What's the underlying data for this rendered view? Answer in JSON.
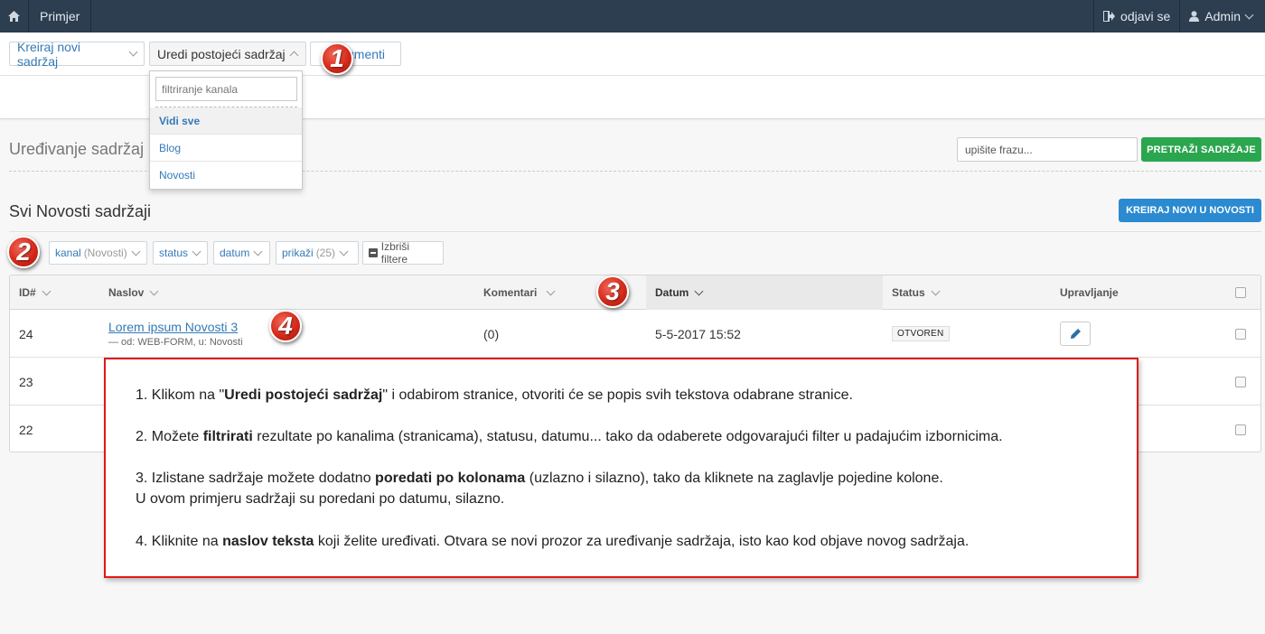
{
  "navbar": {
    "home_icon": "home-icon",
    "brand": "Primjer",
    "logout": "odjavi se",
    "user": "Admin"
  },
  "toolbar": {
    "create_new": "Kreiraj novi sadržaj",
    "edit_existing": "Uredi postojeći sadržaj",
    "documents": "Dokumenti",
    "documents_visible": "umenti"
  },
  "dropdown": {
    "filter_placeholder": "filtriranje kanala",
    "items": [
      "Vidi sve",
      "Blog",
      "Novosti"
    ]
  },
  "section": {
    "title": "Uređivanje sadržaja",
    "title_visible": "Uređivanje sadržaj",
    "search_placeholder": "upišite frazu...",
    "search_button": "PRETRAŽI SADRŽAJE"
  },
  "list": {
    "title": "Svi Novosti sadržaji",
    "create_button": "KREIRAJ NOVI U NOVOSTI"
  },
  "filters": {
    "channel": "kanal",
    "channel_value": "(Novosti)",
    "status": "status",
    "date": "datum",
    "show": "prikaži",
    "show_value": "(25)",
    "clear": "Izbriši filtere"
  },
  "table": {
    "headers": {
      "id": "ID#",
      "title": "Naslov",
      "comments": "Komentari",
      "date": "Datum",
      "status": "Status",
      "manage": "Upravljanje"
    },
    "rows": [
      {
        "id": "24",
        "title": "Lorem ipsum Novosti 3",
        "meta": "— od: WEB-FORM, u: Novosti",
        "comments": "(0)",
        "date": "5-5-2017 15:52",
        "status": "OTVOREN"
      },
      {
        "id": "23"
      },
      {
        "id": "22"
      }
    ]
  },
  "markers": [
    "1",
    "2",
    "3",
    "4"
  ],
  "instructions": {
    "l1_pre": "1. Klikom na \"",
    "l1_bold": "Uredi postojeći sadržaj",
    "l1_post": "\" i odabirom stranice, otvoriti će se popis svih tekstova odabrane stranice.",
    "l2_pre": "2. Možete ",
    "l2_bold": "filtrirati",
    "l2_post": " rezultate po kanalima (stranicama), statusu, datumu... tako da odaberete odgovarajući filter u padajućim izbornicima.",
    "l3_pre": "3. Izlistane sadržaje možete dodatno ",
    "l3_bold": "poredati po kolonama",
    "l3_post": " (uzlazno i silazno), tako da kliknete na zaglavlje pojedine kolone.",
    "l3b": "U ovom primjeru sadržaji su poredani po datumu, silazno.",
    "l4_pre": "4. Kliknite na ",
    "l4_bold": "naslov teksta",
    "l4_post": " koji želite uređivati. Otvara se novi prozor za uređivanje sadržaja, isto kao kod objave novog sadržaja."
  },
  "colors": {
    "navbar": "#2c3e50",
    "link": "#337ab7",
    "success": "#2aa64e",
    "primary": "#2b8ad0",
    "callout_border": "#e01919"
  }
}
